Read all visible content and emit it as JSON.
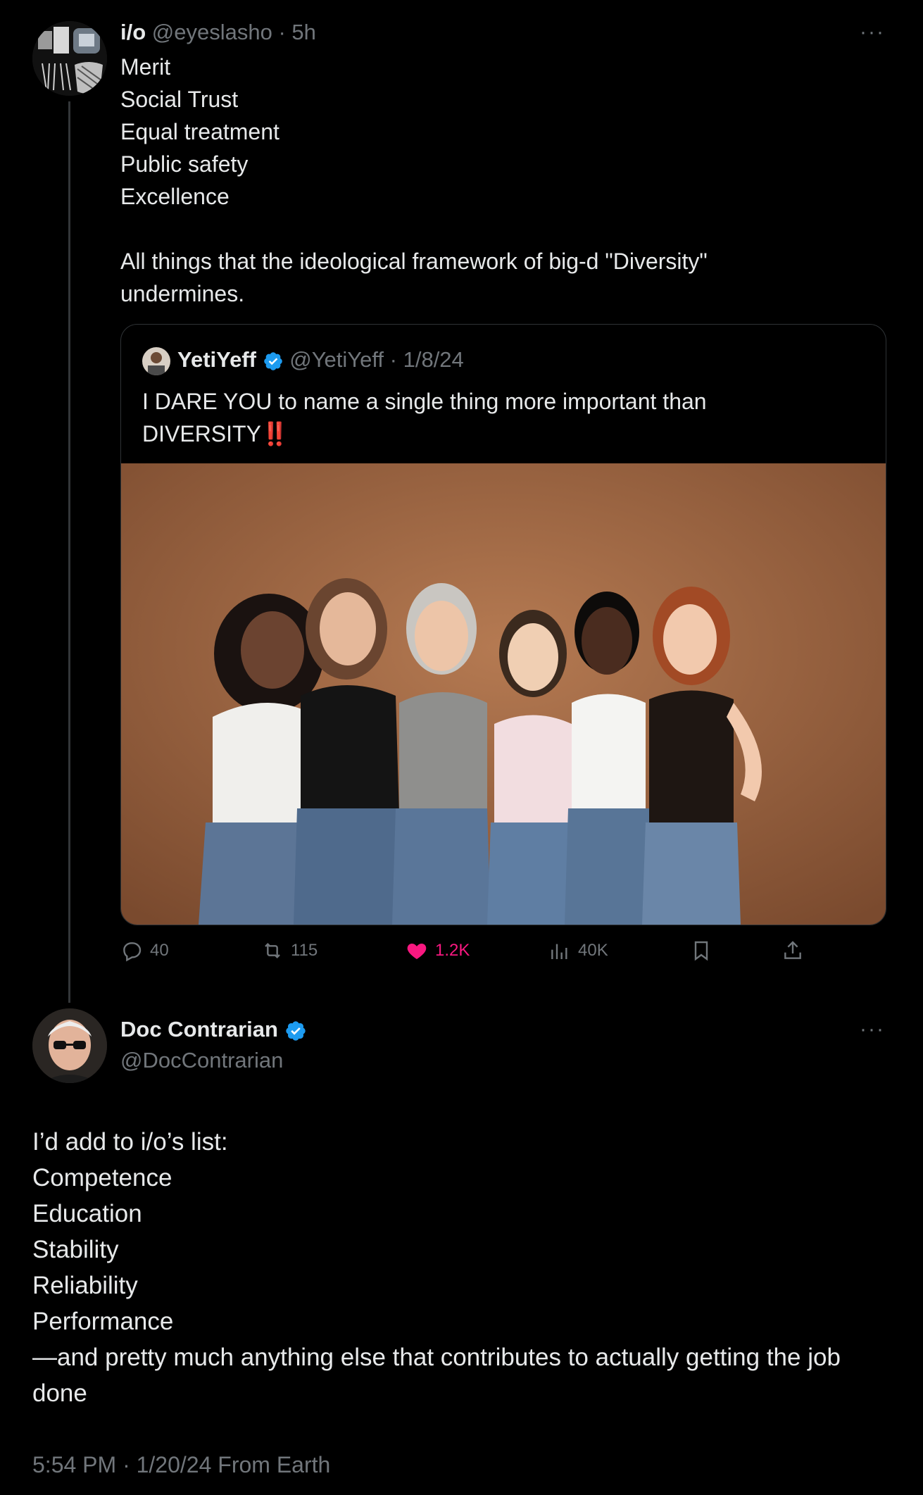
{
  "tweet1": {
    "author_name": "i/o",
    "handle": "@eyeslasho",
    "time": "5h",
    "text": "Merit\nSocial Trust\nEqual treatment\nPublic safety\nExcellence\n\nAll things that the ideological framework of big-d \"Diversity\" undermines.",
    "more_label": "···",
    "quote": {
      "author_name": "YetiYeff",
      "handle": "@YetiYeff",
      "date": "1/8/24",
      "text": "I DARE YOU to name a single thing more important than DIVERSITY",
      "emoji": "‼️"
    },
    "actions": {
      "replies": "40",
      "reposts": "115",
      "likes": "1.2K",
      "views": "40K"
    }
  },
  "tweet2": {
    "author_name": "Doc Contrarian",
    "handle": "@DocContrarian",
    "more_label": "···",
    "text": "I’d add to i/o’s list:\nCompetence\nEducation\nStability\nReliability\nPerformance\n—and pretty much anything else that contributes to actually getting the job done",
    "meta": "5:54 PM · 1/20/24 From Earth"
  },
  "colors": {
    "background": "#000000",
    "text": "#e7e9ea",
    "muted": "#71767b",
    "like": "#f91880",
    "verified": "#1d9bf0"
  }
}
